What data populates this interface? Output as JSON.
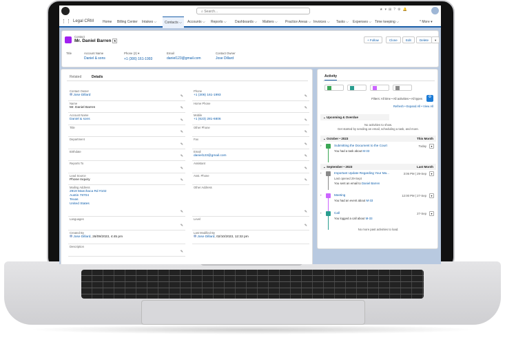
{
  "app": {
    "title": "Legal CRM",
    "search_placeholder": "Search..."
  },
  "nav": [
    "Home",
    "Billing Center",
    "Intakes ⌵",
    "Contacts ⌵",
    "Accounts ⌵",
    "Reports ⌵",
    "Dashboards ⌵",
    "Matters ⌵",
    "Practice Areas ⌵",
    "Invoices ⌵",
    "Tasks ⌵",
    "Expenses ⌵",
    "Time keeping ⌵",
    "* More ▾"
  ],
  "record": {
    "type": "Contact",
    "name": "Mr. Daniel Barren",
    "buttons": [
      "+ Follow",
      "Clone",
      "Edit",
      "Delete"
    ],
    "highlights": [
      {
        "label": "Title",
        "value": ""
      },
      {
        "label": "Account Name",
        "value": "Daniel & sons"
      },
      {
        "label": "Phone (2) ▾",
        "value": "+1 (306) 161-1993"
      },
      {
        "label": "Email",
        "value": "daniel123@gmail.com"
      },
      {
        "label": "Contact Owner",
        "value": "Jose Dillard"
      }
    ]
  },
  "details": {
    "tabs": [
      "Related",
      "Details"
    ],
    "rows": [
      [
        {
          "label": "Contact Owner",
          "value": "Jose Dillard",
          "link": true,
          "user": true
        },
        {
          "label": "Phone",
          "value": "+1 (306) 161-1993",
          "link": true
        }
      ],
      [
        {
          "label": "Name",
          "value": "Mr. Daniel Barren"
        },
        {
          "label": "Home Phone",
          "value": ""
        }
      ],
      [
        {
          "label": "Account Name",
          "value": "Daniel & sons",
          "link": true
        },
        {
          "label": "Mobile",
          "value": "+1 (623) 281-6806",
          "link": true
        }
      ],
      [
        {
          "label": "Title",
          "value": ""
        },
        {
          "label": "Other Phone",
          "value": ""
        }
      ],
      [
        {
          "label": "Department",
          "value": ""
        },
        {
          "label": "Fax",
          "value": ""
        }
      ],
      [
        {
          "label": "Birthdate",
          "value": ""
        },
        {
          "label": "Email",
          "value": "daniel123@gmail.com",
          "link": true
        }
      ],
      [
        {
          "label": "Reports To",
          "value": ""
        },
        {
          "label": "Assistant",
          "value": ""
        }
      ],
      [
        {
          "label": "Lead Source",
          "value": "Phone Inquiry"
        },
        {
          "label": "Asst. Phone",
          "value": ""
        }
      ],
      [
        {
          "label": "Mailing Address",
          "value": "2919 Manchaca Rd #102\nAustin 78704\nTexas\nUnited States",
          "link": true
        },
        {
          "label": "Other Address",
          "value": ""
        }
      ],
      [
        {
          "label": "Languages",
          "value": ""
        },
        {
          "label": "Level",
          "value": ""
        }
      ],
      [
        {
          "label": "Created By",
          "value": "Jose Dillard",
          "suffix": ", 26/09/2023, 4:45 pm",
          "user": true,
          "link": true
        },
        {
          "label": "Last Modified By",
          "value": "Jose Dillard",
          "suffix": ", 02/10/2023, 12:32 pm",
          "user": true,
          "link": true
        }
      ],
      [
        {
          "label": "Description",
          "value": ""
        }
      ]
    ]
  },
  "activity": {
    "title": "Activity",
    "filters": "Filters: All time • All activities • All types",
    "links": [
      "Refresh",
      "Expand All",
      "View All"
    ],
    "upcoming": "Upcoming & Overdue",
    "empty1": "No activities to show.",
    "empty2": "Get started by sending an email, scheduling a task, and more.",
    "oct": "October • 2023",
    "oct_tag": "This Month",
    "sep": "September • 2023",
    "sep_tag": "Last Month",
    "items": [
      {
        "title": "Submitting the Document to the Court",
        "date": "Today",
        "sub": "You had a task about",
        "ref": "M-33",
        "color": "#3ba755"
      },
      {
        "title": "Important Update Regarding Your Ma...",
        "date": "3:06 PM | 29-Sep",
        "extra": "Last opened 29-Sept",
        "sub": "You sent an email to",
        "ref": "Daniel Barren",
        "color": "#8a8a8a"
      },
      {
        "title": "Meeting",
        "date": "12:00 PM | 27-Sep",
        "sub": "You had an event about",
        "ref": "M-33",
        "color": "#cb65ff"
      },
      {
        "title": "Call",
        "date": "27-Sep",
        "sub": "You logged a call about",
        "ref": "M-33",
        "color": "#2a9d8f"
      }
    ],
    "end": "No more past activities to load."
  }
}
